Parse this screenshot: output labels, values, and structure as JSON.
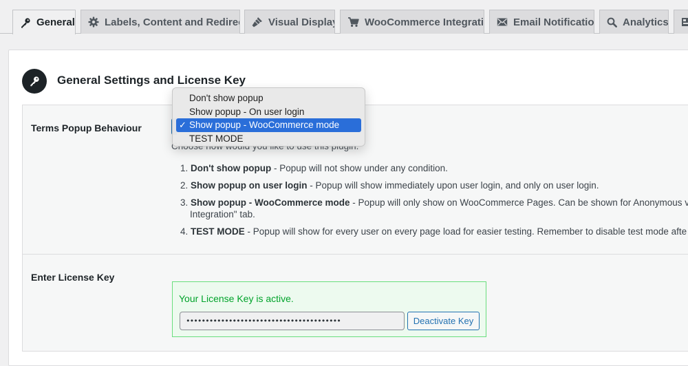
{
  "tabs": [
    {
      "label": "General",
      "icon": "key-icon",
      "active": true
    },
    {
      "label": "Labels, Content and Redirects",
      "icon": "gear-icon",
      "active": false
    },
    {
      "label": "Visual Display",
      "icon": "brush-icon",
      "active": false
    },
    {
      "label": "WooCommerce Integration",
      "icon": "cart-icon",
      "active": false
    },
    {
      "label": "Email Notification",
      "icon": "email-icon",
      "active": false
    },
    {
      "label": "Analytics",
      "icon": "search-icon",
      "active": false
    }
  ],
  "section": {
    "title": "General Settings and License Key",
    "icon": "key-icon"
  },
  "popup_behaviour": {
    "label": "Terms Popup Behaviour",
    "description": "Choose how would you like to use this plugin.",
    "options_list": [
      {
        "num": "1.",
        "title": "Don't show popup",
        "text": " - Popup will not show under any condition.",
        "cont": ""
      },
      {
        "num": "2.",
        "title": "Show popup on user login",
        "text": " - Popup will show immediately upon user login, and only on user login.",
        "cont": ""
      },
      {
        "num": "3.",
        "title": "Show popup - WooCommerce mode",
        "text": " - Popup will only show on WooCommerce Pages. Can be shown for Anonymous vis",
        "cont": "Integration\" tab."
      },
      {
        "num": "4.",
        "title": "TEST MODE",
        "text": " - Popup will show for every user on every page load for easier testing. Remember to disable test mode afte",
        "cont": ""
      }
    ]
  },
  "dropdown": {
    "options": [
      {
        "label": "Don't show popup",
        "selected": false
      },
      {
        "label": "Show popup - On user login",
        "selected": false
      },
      {
        "label": "Show popup - WooCommerce mode",
        "selected": true
      },
      {
        "label": "TEST MODE",
        "selected": false
      }
    ],
    "check_mark": "✓"
  },
  "license": {
    "label": "Enter License Key",
    "status": "Your License Key is active.",
    "masked_value": "••••••••••••••••••••••••••••••••••••••••",
    "deactivate_label": "Deactivate Key"
  },
  "colors": {
    "accent": "#2271b1",
    "success": "#00a32a",
    "selected": "#2a6ed9"
  }
}
